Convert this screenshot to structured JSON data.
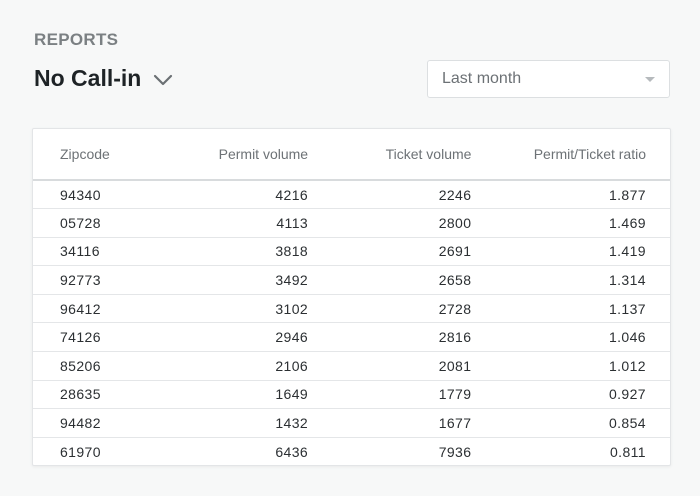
{
  "header": {
    "section_label": "REPORTS",
    "report_title": "No Call-in",
    "report_chevron_icon": "chevron-down-icon"
  },
  "filters": {
    "period": {
      "value": "Last month",
      "caret_icon": "caret-down-icon"
    }
  },
  "table": {
    "columns": [
      "Zipcode",
      "Permit volume",
      "Ticket volume",
      "Permit/Ticket ratio"
    ],
    "rows": [
      [
        "94340",
        "4216",
        "2246",
        "1.877"
      ],
      [
        "05728",
        "4113",
        "2800",
        "1.469"
      ],
      [
        "34116",
        "3818",
        "2691",
        "1.419"
      ],
      [
        "92773",
        "3492",
        "2658",
        "1.314"
      ],
      [
        "96412",
        "3102",
        "2728",
        "1.137"
      ],
      [
        "74126",
        "2946",
        "2816",
        "1.046"
      ],
      [
        "85206",
        "2106",
        "2081",
        "1.012"
      ],
      [
        "28635",
        "1649",
        "1779",
        "0.927"
      ],
      [
        "94482",
        "1432",
        "1677",
        "0.854"
      ],
      [
        "61970",
        "6436",
        "7936",
        "0.811"
      ]
    ]
  }
}
